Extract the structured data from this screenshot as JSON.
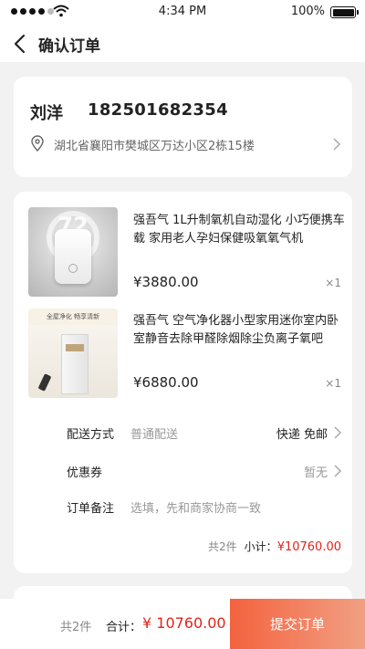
{
  "status_bar": {
    "time": "4:34 PM",
    "battery": "100%"
  },
  "nav": {
    "title": "确认订单"
  },
  "address": {
    "name": "刘洋",
    "phone": "182501682354",
    "full_address": "湖北省襄阳市樊城区万达小区2栋15楼"
  },
  "products": [
    {
      "thumb_text": "72",
      "title": "强吾气 1L升制氧机自动湿化 小巧便携车载 家用老人孕妇保健吸氧氧气机",
      "price": "¥3880.00",
      "qty": "×1"
    },
    {
      "thumb_text": "全屋净化  畅享清新",
      "title": "强吾气 空气净化器小型家用迷你室内卧室静音去除甲醛除烟除尘负离子氧吧",
      "price": "¥6880.00",
      "qty": "×1"
    }
  ],
  "options": {
    "delivery": {
      "label": "配送方式",
      "value": "普通配送",
      "right": "快递 免邮"
    },
    "coupon": {
      "label": "优惠券",
      "right": "暂无"
    },
    "remark": {
      "label": "订单备注",
      "placeholder": "选填，先和商家协商一致"
    }
  },
  "subtotal": {
    "count": "共2件",
    "label": "小计：",
    "amount": "¥10760.00"
  },
  "footer": {
    "count": "共2件",
    "label": "合计：",
    "total": "¥ 10760.00",
    "submit": "提交订单"
  },
  "colors": {
    "accent": "#e1251b",
    "button_start": "#f3623f",
    "button_end": "#f2a083"
  },
  "icons": [
    "wifi-icon",
    "battery-icon",
    "back-arrow-icon",
    "location-pin-icon",
    "chevron-right-icon"
  ]
}
